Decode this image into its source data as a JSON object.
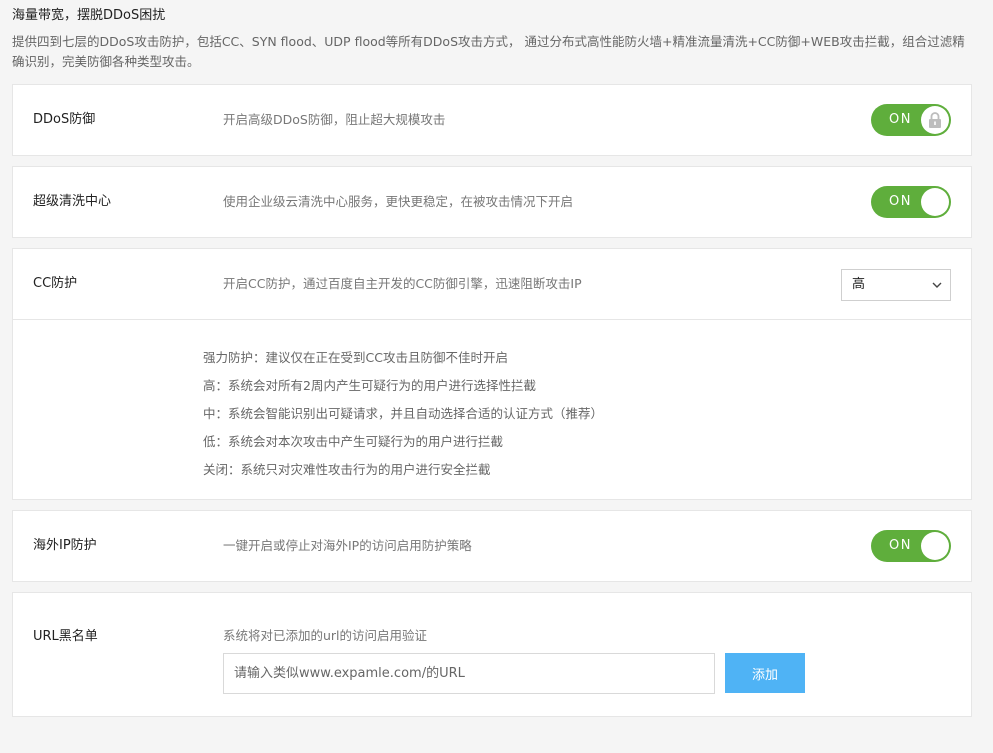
{
  "header": {
    "title": "海量带宽，摆脱DDoS困扰",
    "description": "提供四到七层的DDoS攻击防护，包括CC、SYN flood、UDP flood等所有DDoS攻击方式， 通过分布式高性能防火墙+精准流量清洗+CC防御+WEB攻击拦截，组合过滤精确识别，完美防御各种类型攻击。"
  },
  "ddos": {
    "label": "DDoS防御",
    "desc": "开启高级DDoS防御，阻止超大规模攻击",
    "toggle": "ON",
    "locked": true
  },
  "scrubbing": {
    "label": "超级清洗中心",
    "desc": "使用企业级云清洗中心服务，更快更稳定，在被攻击情况下开启",
    "toggle": "ON"
  },
  "cc": {
    "label": "CC防护",
    "desc": "开启CC防护，通过百度自主开发的CC防御引擎，迅速阻断攻击IP",
    "selected": "高",
    "levels": [
      "强力防护：建议仅在正在受到CC攻击且防御不佳时开启",
      "高：系统会对所有2周内产生可疑行为的用户进行选择性拦截",
      "中：系统会智能识别出可疑请求，并且自动选择合适的认证方式（推荐）",
      "低：系统会对本次攻击中产生可疑行为的用户进行拦截",
      "关闭：系统只对灾难性攻击行为的用户进行安全拦截"
    ]
  },
  "overseas": {
    "label": "海外IP防护",
    "desc": "一键开启或停止对海外IP的访问启用防护策略",
    "toggle": "ON"
  },
  "url_blacklist": {
    "label": "URL黑名单",
    "desc": "系统将对已添加的url的访问启用验证",
    "placeholder": "请输入类似www.expamle.com/的URL",
    "add_label": "添加"
  },
  "colors": {
    "toggle_on": "#5fae3c",
    "add_button": "#4fb3f5"
  }
}
